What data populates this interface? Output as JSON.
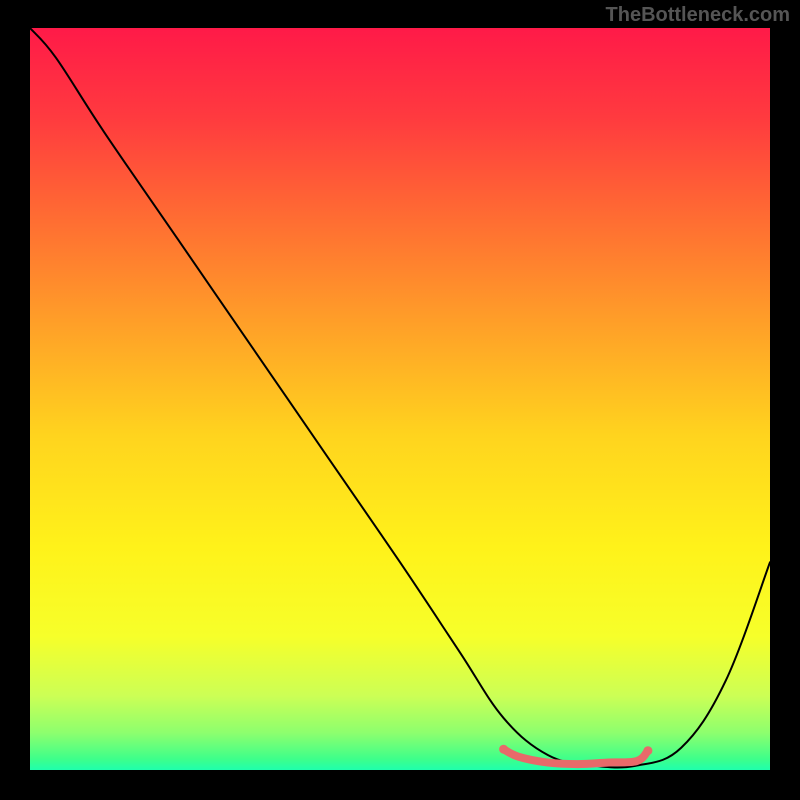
{
  "watermark": "TheBottleneck.com",
  "gradient": {
    "stops": [
      {
        "offset": 0.0,
        "color": "#ff1a48"
      },
      {
        "offset": 0.12,
        "color": "#ff3a3f"
      },
      {
        "offset": 0.25,
        "color": "#ff6a33"
      },
      {
        "offset": 0.4,
        "color": "#ffa028"
      },
      {
        "offset": 0.55,
        "color": "#ffd41e"
      },
      {
        "offset": 0.7,
        "color": "#fff21a"
      },
      {
        "offset": 0.82,
        "color": "#f6ff2a"
      },
      {
        "offset": 0.9,
        "color": "#ccff55"
      },
      {
        "offset": 0.95,
        "color": "#8dff6e"
      },
      {
        "offset": 0.985,
        "color": "#3eff8a"
      },
      {
        "offset": 1.0,
        "color": "#1fffad"
      }
    ]
  },
  "chart_data": {
    "type": "line",
    "title": "",
    "xlabel": "",
    "ylabel": "",
    "xlim": [
      0,
      100
    ],
    "ylim": [
      0,
      100
    ],
    "series": [
      {
        "name": "bottleneck-curve",
        "x": [
          0.0,
          3.5,
          10.0,
          20.0,
          30.0,
          40.0,
          50.0,
          58.0,
          64.0,
          70.0,
          76.0,
          82.0,
          88.0,
          94.0,
          100.0
        ],
        "y": [
          100.0,
          96.0,
          86.0,
          71.5,
          57.0,
          42.5,
          28.0,
          16.0,
          7.0,
          2.0,
          0.6,
          0.6,
          3.0,
          12.0,
          28.0
        ],
        "stroke": "#000000",
        "stroke_width": 2
      },
      {
        "name": "bottom-highlight",
        "x": [
          64.0,
          66.0,
          70.0,
          74.0,
          78.0,
          82.0,
          83.5
        ],
        "y": [
          2.8,
          1.8,
          1.0,
          0.8,
          1.0,
          1.2,
          2.6
        ],
        "stroke": "#e86a6a",
        "stroke_width": 8
      }
    ],
    "annotations": []
  }
}
